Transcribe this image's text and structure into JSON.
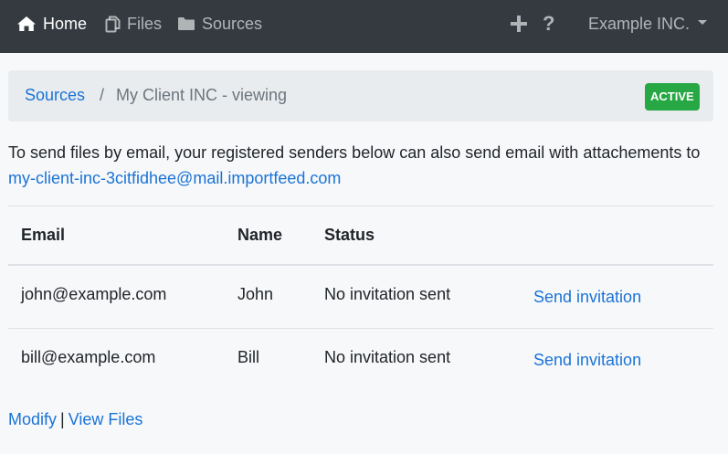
{
  "navbar": {
    "home_label": "Home",
    "files_label": "Files",
    "sources_label": "Sources",
    "plus_icon": "plus-icon",
    "help_label": "?",
    "account_label": "Example INC."
  },
  "breadcrumb": {
    "sources_link": "Sources",
    "separator": "/",
    "current": "My Client INC - viewing",
    "status_badge": "ACTIVE"
  },
  "intro": {
    "text": "To send files by email, your registered senders below can also send email with attachements to",
    "email": "my-client-inc-3citfidhee@mail.importfeed.com"
  },
  "table": {
    "headers": {
      "email": "Email",
      "name": "Name",
      "status": "Status"
    },
    "rows": [
      {
        "email": "john@example.com",
        "name": "John",
        "status": "No invitation sent",
        "action": "Send invitation"
      },
      {
        "email": "bill@example.com",
        "name": "Bill",
        "status": "No invitation sent",
        "action": "Send invitation"
      }
    ]
  },
  "footer": {
    "modify_label": "Modify",
    "separator": "|",
    "view_files_label": "View Files"
  },
  "colors": {
    "navbar_bg": "#343a40",
    "link": "#1a73d6",
    "badge_bg": "#28a745",
    "breadcrumb_bg": "#e9ecef"
  }
}
